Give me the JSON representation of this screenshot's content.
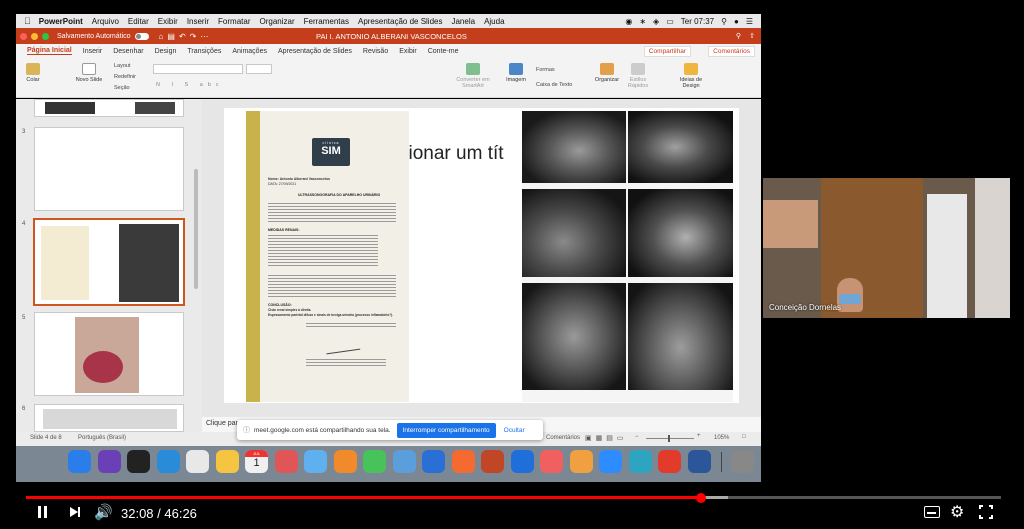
{
  "menubar": {
    "items": [
      "PowerPoint",
      "Arquivo",
      "Editar",
      "Exibir",
      "Inserir",
      "Formatar",
      "Organizar",
      "Ferramentas",
      "Apresentação de Slides",
      "Janela",
      "Ajuda"
    ],
    "clock": "Ter 07:37"
  },
  "titlebar": {
    "autosave": "Salvamento Automático",
    "doc_title": "PAI I. ANTONIO ALBERANI VASCONCELOS"
  },
  "ribbon": {
    "tabs": [
      "Página Inicial",
      "Inserir",
      "Desenhar",
      "Design",
      "Transições",
      "Animações",
      "Apresentação de Slides",
      "Revisão",
      "Exibir",
      "Conte-me"
    ],
    "share": "Compartilhar",
    "comments": "Comentários",
    "paste": "Colar",
    "new_slide": "Novo Slide",
    "layout": "Layout",
    "reset": "Redefinir",
    "section": "Seção",
    "convert": "Converter em SmartArt",
    "image": "Imagem",
    "shapes": "Formas",
    "textbox": "Caixa de Texto",
    "arrange": "Organizar",
    "quick_styles": "Estilos Rápidos",
    "design_ideas": "Ideias de Design"
  },
  "thumbnails": {
    "numbers": [
      "3",
      "4",
      "5",
      "6"
    ]
  },
  "slide": {
    "title_fragment": "cionar um tít",
    "document": {
      "logo_top": "clínica",
      "logo": "SIM",
      "patient": "Nome: Antonio Alberani Vasconcelos",
      "date": "DATA: 27/09/2021",
      "heading": "ULTRASSONOGRAFIA DO APARELHO URINÁRIO",
      "section1": "MEDIDAS RENAIS:",
      "section2": "CONCLUSÃO:",
      "conclusion1": "Cisto renal simples à direita.",
      "conclusion2": "Espessamento parietal difuso e sinais de bexiga urinária (processo inflamatório?)."
    }
  },
  "notes": {
    "placeholder": "Clique para"
  },
  "statusbar": {
    "slide_info": "Slide 4 de 8",
    "language": "Português (Brasil)",
    "comments": "Comentários",
    "zoom": "105%"
  },
  "share_popup": {
    "message": "meet.google.com está compartilhando sua tela.",
    "stop": "Interromper compartilhamento",
    "hide": "Ocultar"
  },
  "dock": {
    "calendar_month": "JUL",
    "calendar_day": "1",
    "colors": [
      "#2b7de9",
      "#6b3fb5",
      "#222222",
      "#2a8bd8",
      "#e8e8e8",
      "#f5c542",
      "#f0f0f0",
      "#e05555",
      "#60b0f0",
      "#f08a2a",
      "#48c35a",
      "#5a9fdc",
      "#2a6fd6",
      "#f46a30",
      "#c14626",
      "#1e6fd9",
      "#f06060",
      "#f0a040",
      "#2d8cff",
      "#2da4c0",
      "#e23b2b",
      "#2b579a",
      "#888888"
    ]
  },
  "webcam": {
    "name": "Conceição Dornelas"
  },
  "video": {
    "time": "32:08 / 46:26",
    "progress": 0.692
  }
}
